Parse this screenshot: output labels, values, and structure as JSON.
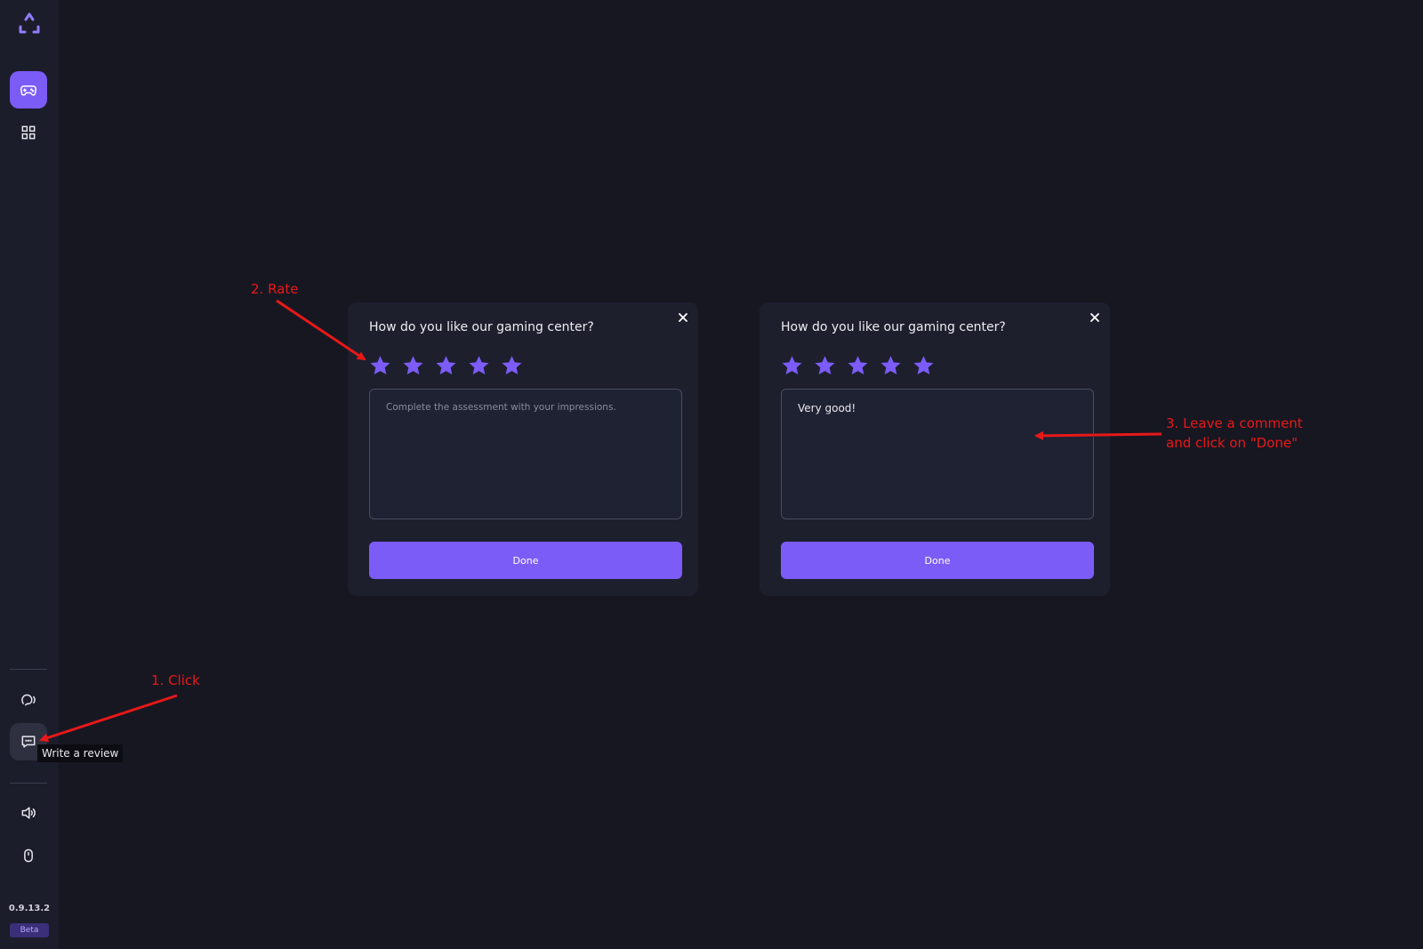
{
  "sidebar": {
    "items": [
      {
        "icon": "gamepad-icon",
        "active": true
      },
      {
        "icon": "grid-icon",
        "active": false
      },
      {
        "icon": "support-icon",
        "active": false
      },
      {
        "icon": "review-icon",
        "active": false,
        "hovered": true
      },
      {
        "icon": "sound-icon",
        "active": false
      },
      {
        "icon": "mouse-icon",
        "active": false
      }
    ],
    "tooltip": "Write a review",
    "version": "0.9.13.2",
    "beta_badge": "Beta"
  },
  "dialog_left": {
    "title": "How do you like our gaming center?",
    "star_count": 5,
    "rating": 5,
    "comment_value": "",
    "comment_placeholder": "Complete the assessment with your impressions.",
    "done_label": "Done"
  },
  "dialog_right": {
    "title": "How do you like our gaming center?",
    "star_count": 5,
    "rating": 5,
    "comment_value": "Very good!",
    "comment_placeholder": "Complete the assessment with your impressions.",
    "done_label": "Done"
  },
  "annotations": {
    "step1": "1. Click",
    "step2": "2. Rate",
    "step3_line1": "3. Leave a comment",
    "step3_line2": "and click on \"Done\""
  },
  "colors": {
    "accent": "#7c5cf6",
    "background": "#171722",
    "sidebar": "#1b1d2b",
    "dialog": "#1d1f2d",
    "annotation": "#e81818"
  }
}
